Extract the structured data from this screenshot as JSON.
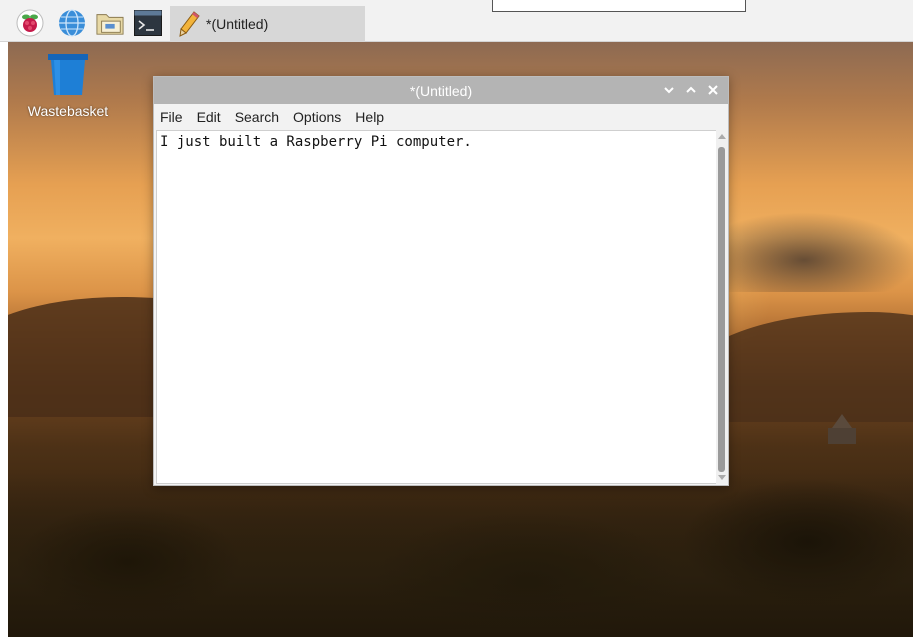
{
  "taskbar": {
    "launchers": [
      {
        "name": "raspberry-menu-icon"
      },
      {
        "name": "web-browser-icon"
      },
      {
        "name": "file-manager-icon"
      },
      {
        "name": "terminal-icon"
      }
    ],
    "task": {
      "label": "*(Untitled)",
      "icon": "text-editor-icon"
    }
  },
  "desktop": {
    "wastebasket_label": "Wastebasket"
  },
  "window": {
    "title": "*(Untitled)",
    "controls": {
      "minimize": "⌄",
      "maximize": "⌃",
      "close": "✕"
    },
    "menu": [
      "File",
      "Edit",
      "Search",
      "Options",
      "Help"
    ],
    "content": "I just built a Raspberry Pi computer."
  },
  "colors": {
    "titlebar": "#b4b4b4",
    "taskbar": "#f2f2f2",
    "wastebasket": "#1e7fd6"
  }
}
